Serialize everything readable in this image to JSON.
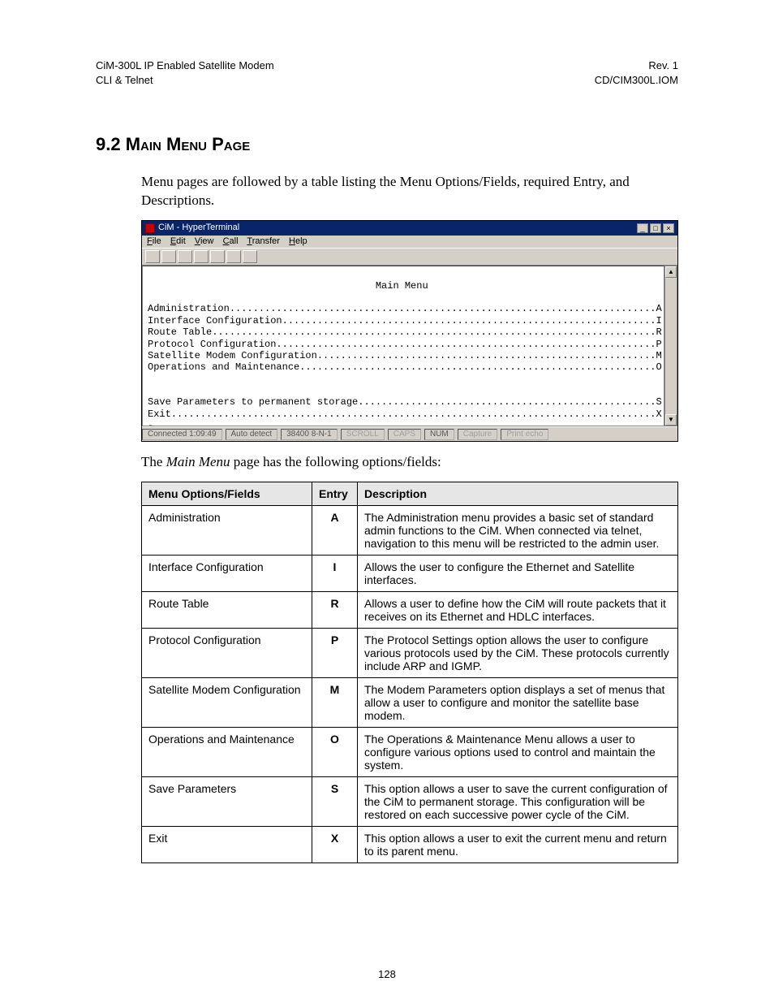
{
  "header": {
    "left_line1": "CiM-300L IP Enabled Satellite Modem",
    "left_line2": "CLI & Telnet",
    "right_line1": "Rev. 1",
    "right_line2": "CD/CIM300L.IOM"
  },
  "section": {
    "number": "9.2",
    "title_caps": "Main Menu Page"
  },
  "intro_para": "Menu pages are followed by a table listing the Menu Options/Fields, required Entry, and Descriptions.",
  "hyperterm": {
    "title": "CiM - HyperTerminal",
    "menus": [
      "File",
      "Edit",
      "View",
      "Call",
      "Transfer",
      "Help"
    ],
    "term_heading": "Main Menu",
    "lines": [
      {
        "label": "Administration",
        "key": "A"
      },
      {
        "label": "Interface Configuration",
        "key": "I"
      },
      {
        "label": "Route Table",
        "key": "R"
      },
      {
        "label": "Protocol Configuration",
        "key": "P"
      },
      {
        "label": "Satellite Modem Configuration",
        "key": "M"
      },
      {
        "label": "Operations and Maintenance",
        "key": "O"
      }
    ],
    "lines2": [
      {
        "label": "Save Parameters to permanent storage",
        "key": "S"
      },
      {
        "label": "Exit",
        "key": "X"
      }
    ],
    "status": {
      "connected": "Connected 1:09:49",
      "detect": "Auto detect",
      "baud": "38400 8-N-1",
      "scroll": "SCROLL",
      "caps": "CAPS",
      "num": "NUM",
      "capture": "Capture",
      "echo": "Print echo"
    }
  },
  "caption_before_italic": "The ",
  "caption_italic": "Main Menu",
  "caption_after_italic": " page has the following options/fields:",
  "table": {
    "headers": [
      "Menu Options/Fields",
      "Entry",
      "Description"
    ],
    "rows": [
      {
        "mo": "Administration",
        "entry": "A",
        "desc": "The Administration menu provides a basic set of standard admin functions to the CiM. When connected via telnet, navigation to this menu will be restricted to the admin user."
      },
      {
        "mo": "Interface Configuration",
        "entry": "I",
        "desc": "Allows the user to configure the Ethernet and Satellite interfaces."
      },
      {
        "mo": "Route Table",
        "entry": "R",
        "desc": "Allows a user to define how the CiM will route packets that it receives on its Ethernet and HDLC interfaces."
      },
      {
        "mo": "Protocol Configuration",
        "entry": "P",
        "desc": "The Protocol Settings option allows the user to configure various protocols used by the CiM. These protocols currently include ARP and IGMP."
      },
      {
        "mo": "Satellite Modem Configuration",
        "entry": "M",
        "desc": "The Modem Parameters option displays a set of menus that allow a user to configure and monitor the satellite base modem."
      },
      {
        "mo": "Operations and Maintenance",
        "entry": "O",
        "desc": "The Operations & Maintenance Menu allows a user to configure various options used to control and maintain the system."
      },
      {
        "mo": "Save Parameters",
        "entry": "S",
        "desc": "This option allows a user to save the current configuration of the CiM to permanent storage. This configuration will be restored on each successive power cycle of the CiM."
      },
      {
        "mo": "Exit",
        "entry": "X",
        "desc": "This option allows a user to exit the current menu and return to its parent menu."
      }
    ]
  },
  "page_number": "128"
}
